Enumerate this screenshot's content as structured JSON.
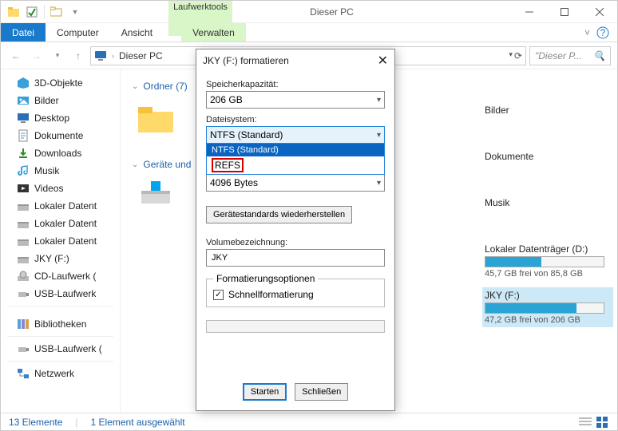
{
  "window": {
    "title": "Dieser PC",
    "contextual_tab_group": "Laufwerktools"
  },
  "ribbon": {
    "file": "Datei",
    "tabs": [
      "Computer",
      "Ansicht",
      "Verwalten"
    ]
  },
  "address": {
    "path": "Dieser PC",
    "search_placeholder": "\"Dieser P..."
  },
  "sidebar": {
    "items": [
      {
        "label": "3D-Objekte",
        "icon": "objects3d"
      },
      {
        "label": "Bilder",
        "icon": "pictures"
      },
      {
        "label": "Desktop",
        "icon": "desktop"
      },
      {
        "label": "Dokumente",
        "icon": "documents"
      },
      {
        "label": "Downloads",
        "icon": "downloads"
      },
      {
        "label": "Musik",
        "icon": "music"
      },
      {
        "label": "Videos",
        "icon": "videos"
      },
      {
        "label": "Lokaler Datent",
        "icon": "drive"
      },
      {
        "label": "Lokaler Datent",
        "icon": "drive"
      },
      {
        "label": "Lokaler Datent",
        "icon": "drive"
      },
      {
        "label": "JKY (F:)",
        "icon": "drive"
      },
      {
        "label": "CD-Laufwerk (",
        "icon": "optical"
      },
      {
        "label": "USB-Laufwerk",
        "icon": "usb"
      }
    ],
    "groups": [
      {
        "label": "Bibliotheken",
        "icon": "libraries"
      },
      {
        "label": "USB-Laufwerk (",
        "icon": "usb"
      },
      {
        "label": "Netzwerk",
        "icon": "network"
      }
    ]
  },
  "content": {
    "group1": "Ordner (7)",
    "group2": "Geräte und"
  },
  "rightcol": {
    "items": [
      "Bilder",
      "Dokumente",
      "Musik"
    ],
    "drives": [
      {
        "name": "Lokaler Datenträger (D:)",
        "free": "45,7 GB frei von 85,8 GB",
        "pct": 47
      },
      {
        "name": "JKY (F:)",
        "free": "47,2 GB frei von 206 GB",
        "pct": 77,
        "selected": true
      }
    ]
  },
  "status": {
    "count": "13 Elemente",
    "selection": "1 Element ausgewählt"
  },
  "dialog": {
    "title": "JKY (F:) formatieren",
    "capacity_label": "Speicherkapazität:",
    "capacity_value": "206 GB",
    "fs_label": "Dateisystem:",
    "fs_value": "NTFS (Standard)",
    "fs_options": [
      "NTFS (Standard)",
      "REFS"
    ],
    "alloc_value": "4096 Bytes",
    "restore_btn": "Gerätestandards wiederherstellen",
    "vol_label": "Volumebezeichnung:",
    "vol_value": "JKY",
    "opts_legend": "Formatierungsoptionen",
    "quick_format": "Schnellformatierung",
    "start_btn": "Starten",
    "close_btn": "Schließen"
  }
}
